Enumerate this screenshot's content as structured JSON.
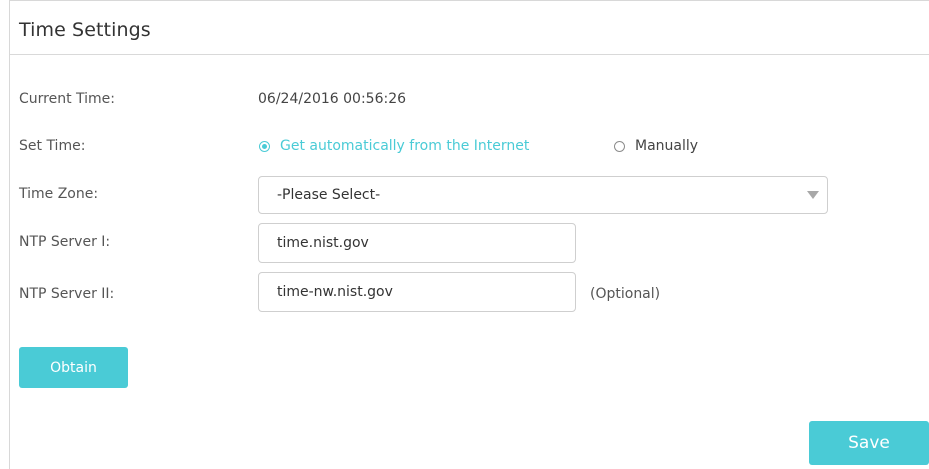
{
  "section": {
    "title": "Time Settings"
  },
  "current_time": {
    "label": "Current Time:",
    "value": "06/24/2016 00:56:26"
  },
  "set_time": {
    "label": "Set Time:",
    "options": [
      {
        "label": "Get automatically from the Internet",
        "selected": true
      },
      {
        "label": "Manually",
        "selected": false
      }
    ]
  },
  "time_zone": {
    "label": "Time Zone:",
    "selected": "-Please Select-"
  },
  "ntp1": {
    "label": "NTP Server I:",
    "value": "time.nist.gov"
  },
  "ntp2": {
    "label": "NTP Server II:",
    "value": "time-nw.nist.gov",
    "hint": "(Optional)"
  },
  "buttons": {
    "obtain": "Obtain",
    "save": "Save"
  },
  "colors": {
    "accent": "#4acbd6",
    "border": "#cfcfcf",
    "text": "#333333"
  },
  "icons": {
    "dropdown": "triangle-down-icon",
    "radio_checked": "radio-checked-icon",
    "radio_unchecked": "radio-unchecked-icon"
  }
}
